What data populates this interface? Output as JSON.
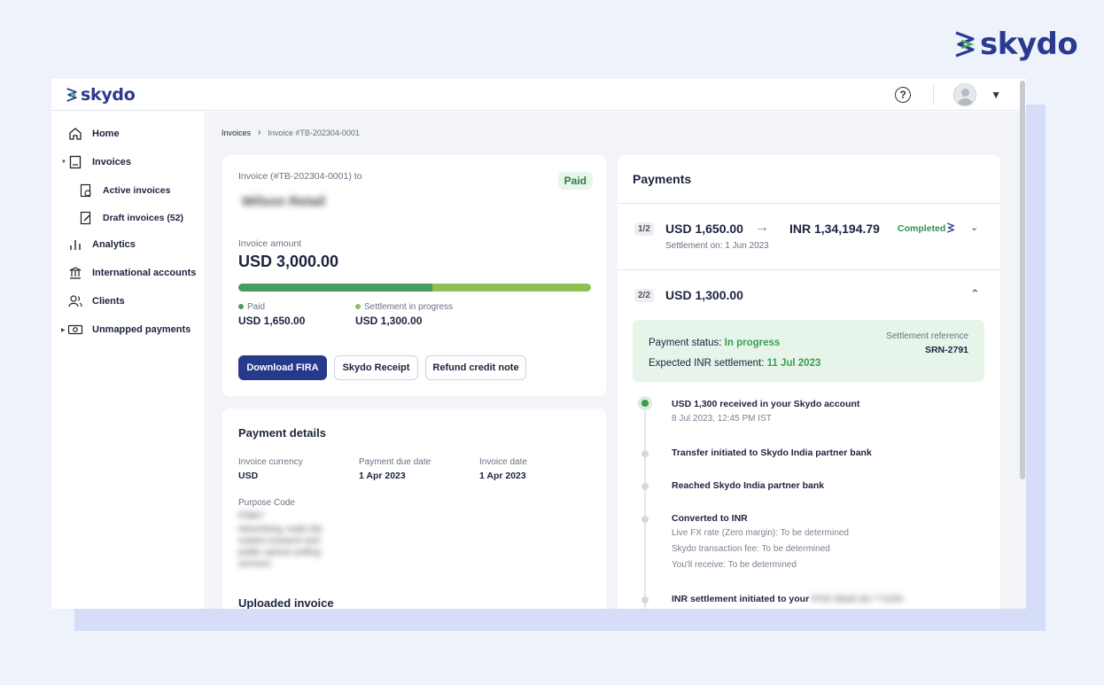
{
  "brand": {
    "name": "skydo"
  },
  "sidebar": {
    "items": [
      {
        "label": "Home",
        "icon": "home-icon"
      },
      {
        "label": "Invoices",
        "icon": "invoice-icon"
      },
      {
        "label": "Active invoices",
        "icon": "active-invoice-icon"
      },
      {
        "label": "Draft invoices (52)",
        "icon": "draft-invoice-icon"
      },
      {
        "label": "Analytics",
        "icon": "analytics-icon"
      },
      {
        "label": "International accounts",
        "icon": "bank-icon"
      },
      {
        "label": "Clients",
        "icon": "clients-icon"
      },
      {
        "label": "Unmapped payments",
        "icon": "cash-icon"
      }
    ]
  },
  "breadcrumb": {
    "root": "Invoices",
    "current": "Invoice #TB-202304-0001"
  },
  "invoice": {
    "title": "Invoice (#TB-202304-0001) to",
    "status": "Paid",
    "client": "Wilson Retail",
    "amount_label": "Invoice amount",
    "amount": "USD 3,000.00",
    "paid_fraction": 0.55,
    "paid_label": "Paid",
    "paid_value": "USD 1,650.00",
    "progress_label": "Settlement in progress",
    "progress_value": "USD 1,300.00",
    "buttons": {
      "fira": "Download FIRA",
      "receipt": "Skydo Receipt",
      "refund": "Refund credit note"
    }
  },
  "payment_details": {
    "title": "Payment details",
    "currency_label": "Invoice currency",
    "currency": "USD",
    "due_label": "Payment due date",
    "due": "1 Apr 2023",
    "date_label": "Invoice date",
    "date": "1 Apr 2023",
    "purpose_label": "Purpose Code",
    "purpose_code": "P0807",
    "purpose_desc": "Advertising, trade fair, market research and public opinion polling services",
    "uploaded_label": "Uploaded invoice"
  },
  "payments": {
    "title": "Payments",
    "p1": {
      "frac": "1/2",
      "usd": "USD 1,650.00",
      "arrow": "→",
      "inr": "INR 1,34,194.79",
      "status": "Completed",
      "settled": "Settlement on: 1 Jun 2023"
    },
    "p2": {
      "frac": "2/2",
      "usd": "USD 1,300.00",
      "status_label": "Payment status:",
      "status": "In progress",
      "expected_label": "Expected INR settlement:",
      "expected": "11 Jul 2023",
      "ref_label": "Settlement reference",
      "ref": "SRN-2791"
    },
    "timeline": [
      {
        "title": "USD 1,300 received in your Skydo account",
        "sub": "8 Jul 2023, 12:45 PM IST"
      },
      {
        "title": "Transfer initiated to Skydo India partner bank"
      },
      {
        "title": "Reached Skydo India partner bank"
      },
      {
        "title": "Converted to INR",
        "subs": [
          "Live FX rate (Zero margin): To be determined",
          "Skydo transaction fee: To be determined",
          "You'll receive: To be determined"
        ]
      },
      {
        "title": "INR settlement initiated to your",
        "masked": "IFSC Bank A/c **1234"
      }
    ]
  },
  "colors": {
    "brand": "#2b3a8f",
    "accent_green": "#4a9b5f",
    "light_green": "#8dc152",
    "primary_button": "#263a8c"
  }
}
